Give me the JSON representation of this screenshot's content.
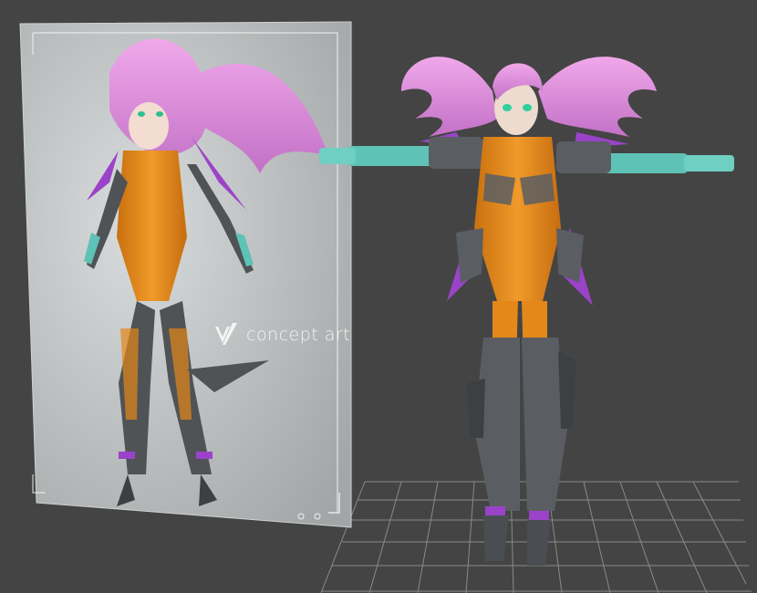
{
  "concept_board": {
    "label": "concept art",
    "logo_icon": "stylized-v-logo-icon"
  },
  "colors": {
    "viewport_background": "#444444",
    "grid_line": "#8a8a8a",
    "board_panel": "#b9bcbd",
    "suit_orange": "#e4881a",
    "hair_pink": "#d98ad7",
    "armor_gray": "#5a5e63",
    "accent_teal": "#5fc2b6",
    "accent_purple": "#9a43c8"
  },
  "icons": [
    "stylized-v-logo-icon",
    "board-corner-dot-icon"
  ]
}
